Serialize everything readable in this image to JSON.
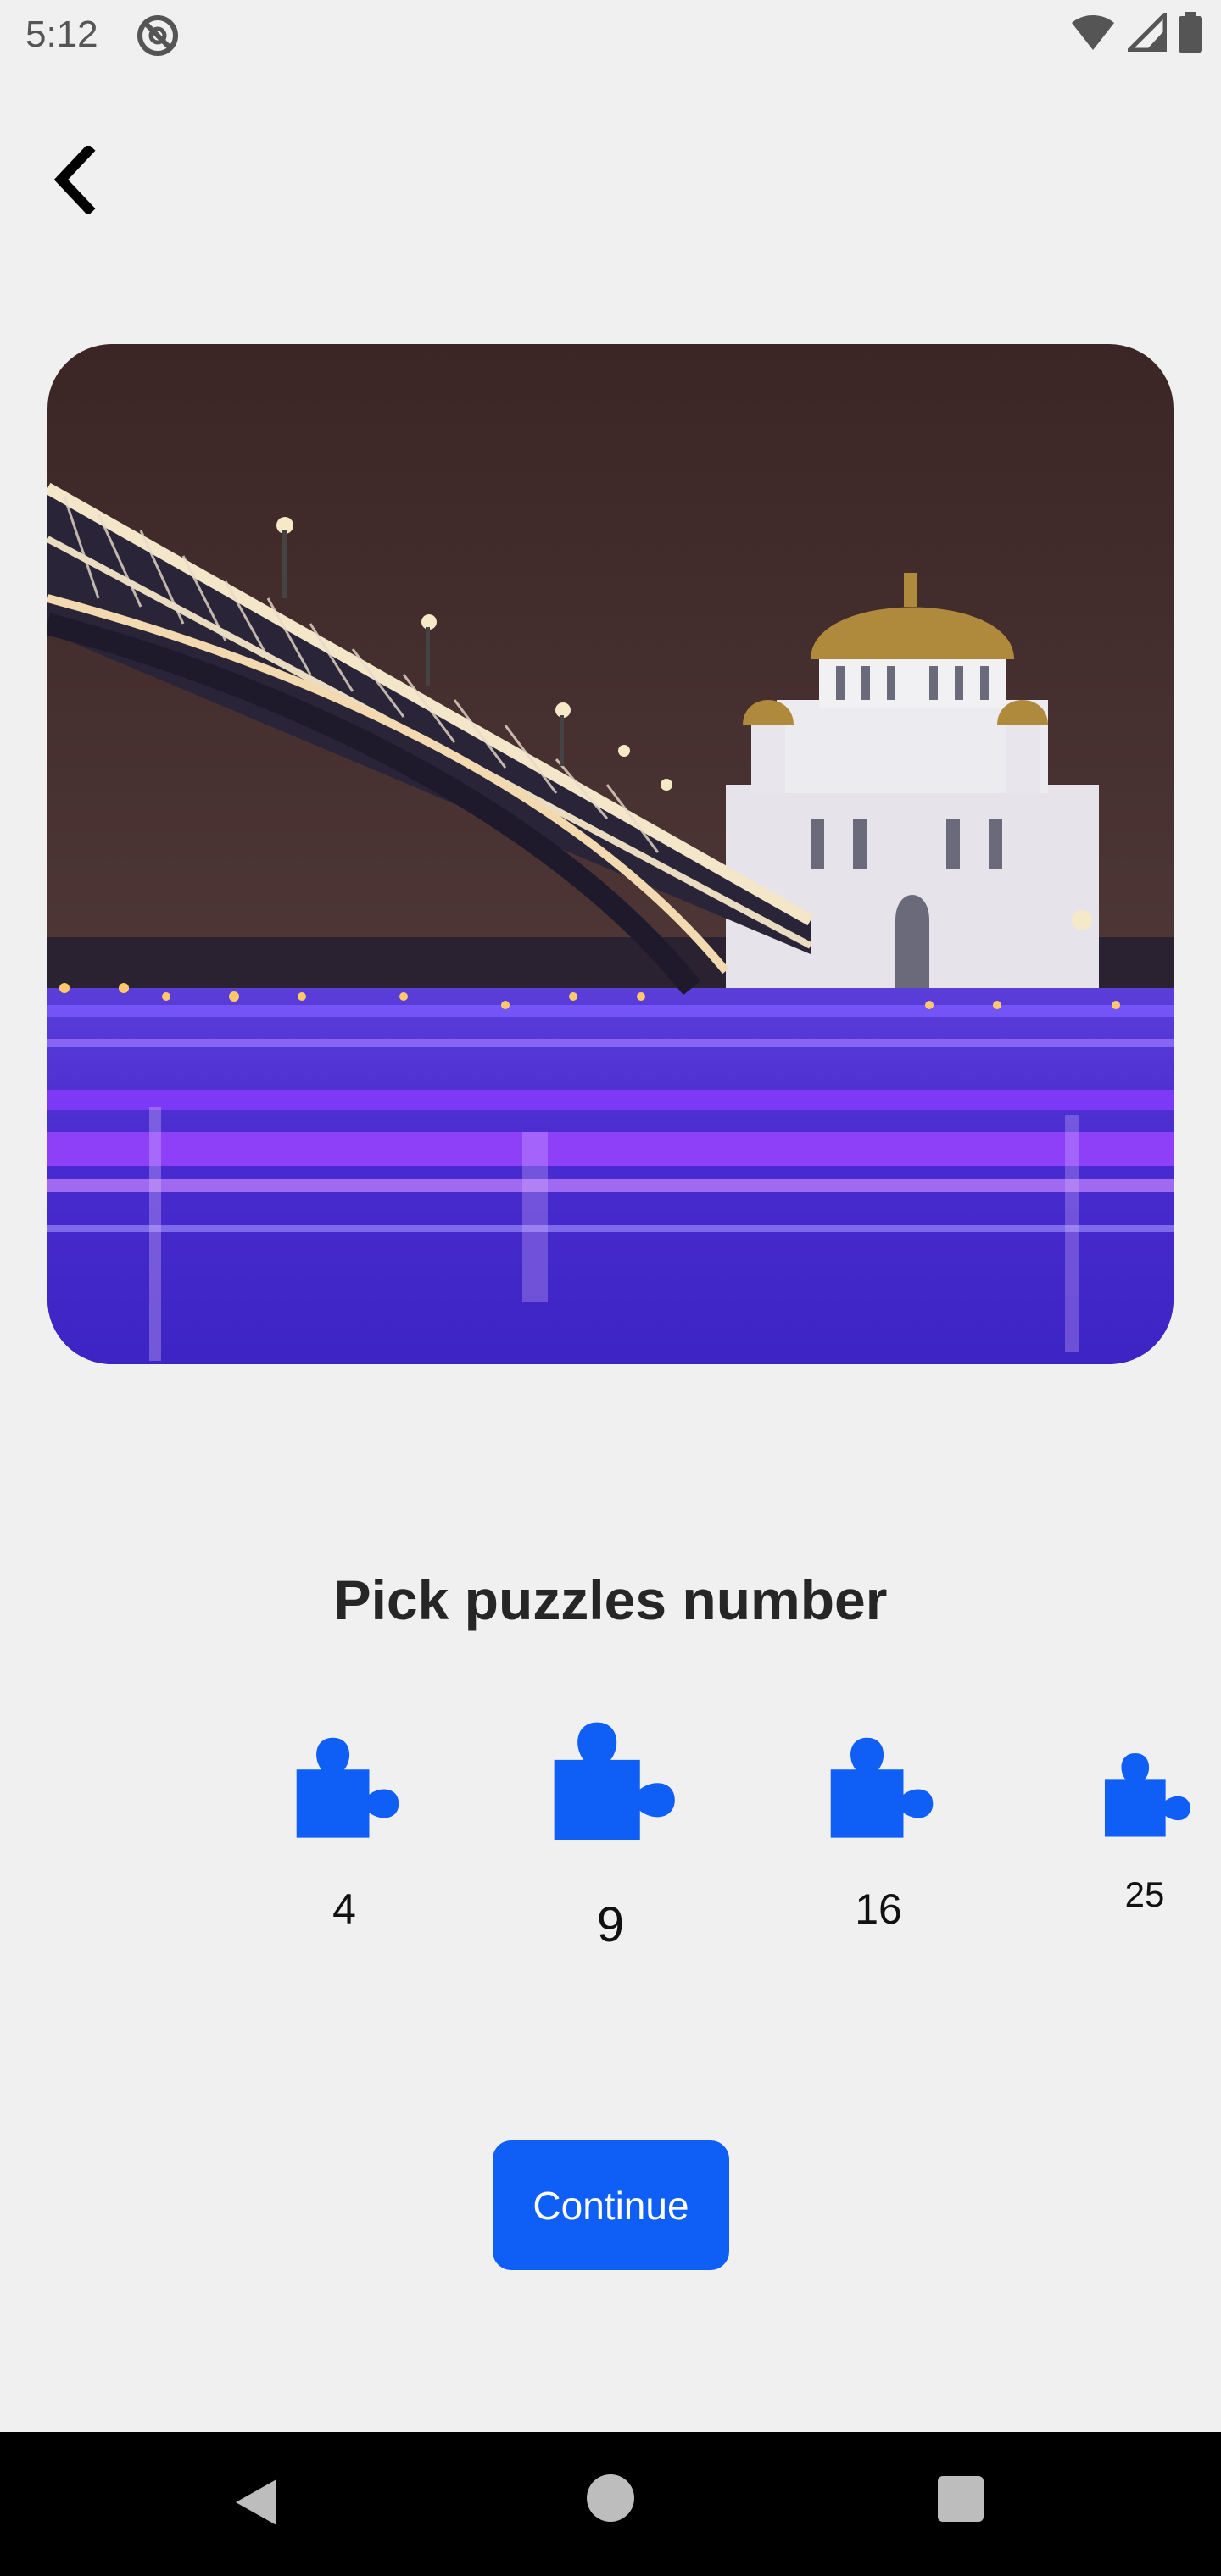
{
  "status_bar": {
    "time": "5:12",
    "icons": [
      "do-not-disturb-icon",
      "wifi-icon",
      "cell-signal-icon",
      "battery-icon"
    ]
  },
  "header": {
    "back_icon": "chevron-left-icon"
  },
  "image": {
    "subject": ""
  },
  "main": {
    "title": "Pick puzzles number",
    "options": [
      {
        "label": "4",
        "icon": "puzzle-piece-icon"
      },
      {
        "label": "9",
        "icon": "puzzle-piece-icon"
      },
      {
        "label": "16",
        "icon": "puzzle-piece-icon"
      },
      {
        "label": "25",
        "icon": "puzzle-piece-icon"
      }
    ],
    "continue_label": "Continue"
  },
  "nav_bar": {
    "icons": [
      "back-triangle-icon",
      "home-circle-icon",
      "recents-square-icon"
    ]
  },
  "colors": {
    "accent": "#0f5ef5",
    "background": "#f1f0f1",
    "nav_bar": "#000000"
  }
}
